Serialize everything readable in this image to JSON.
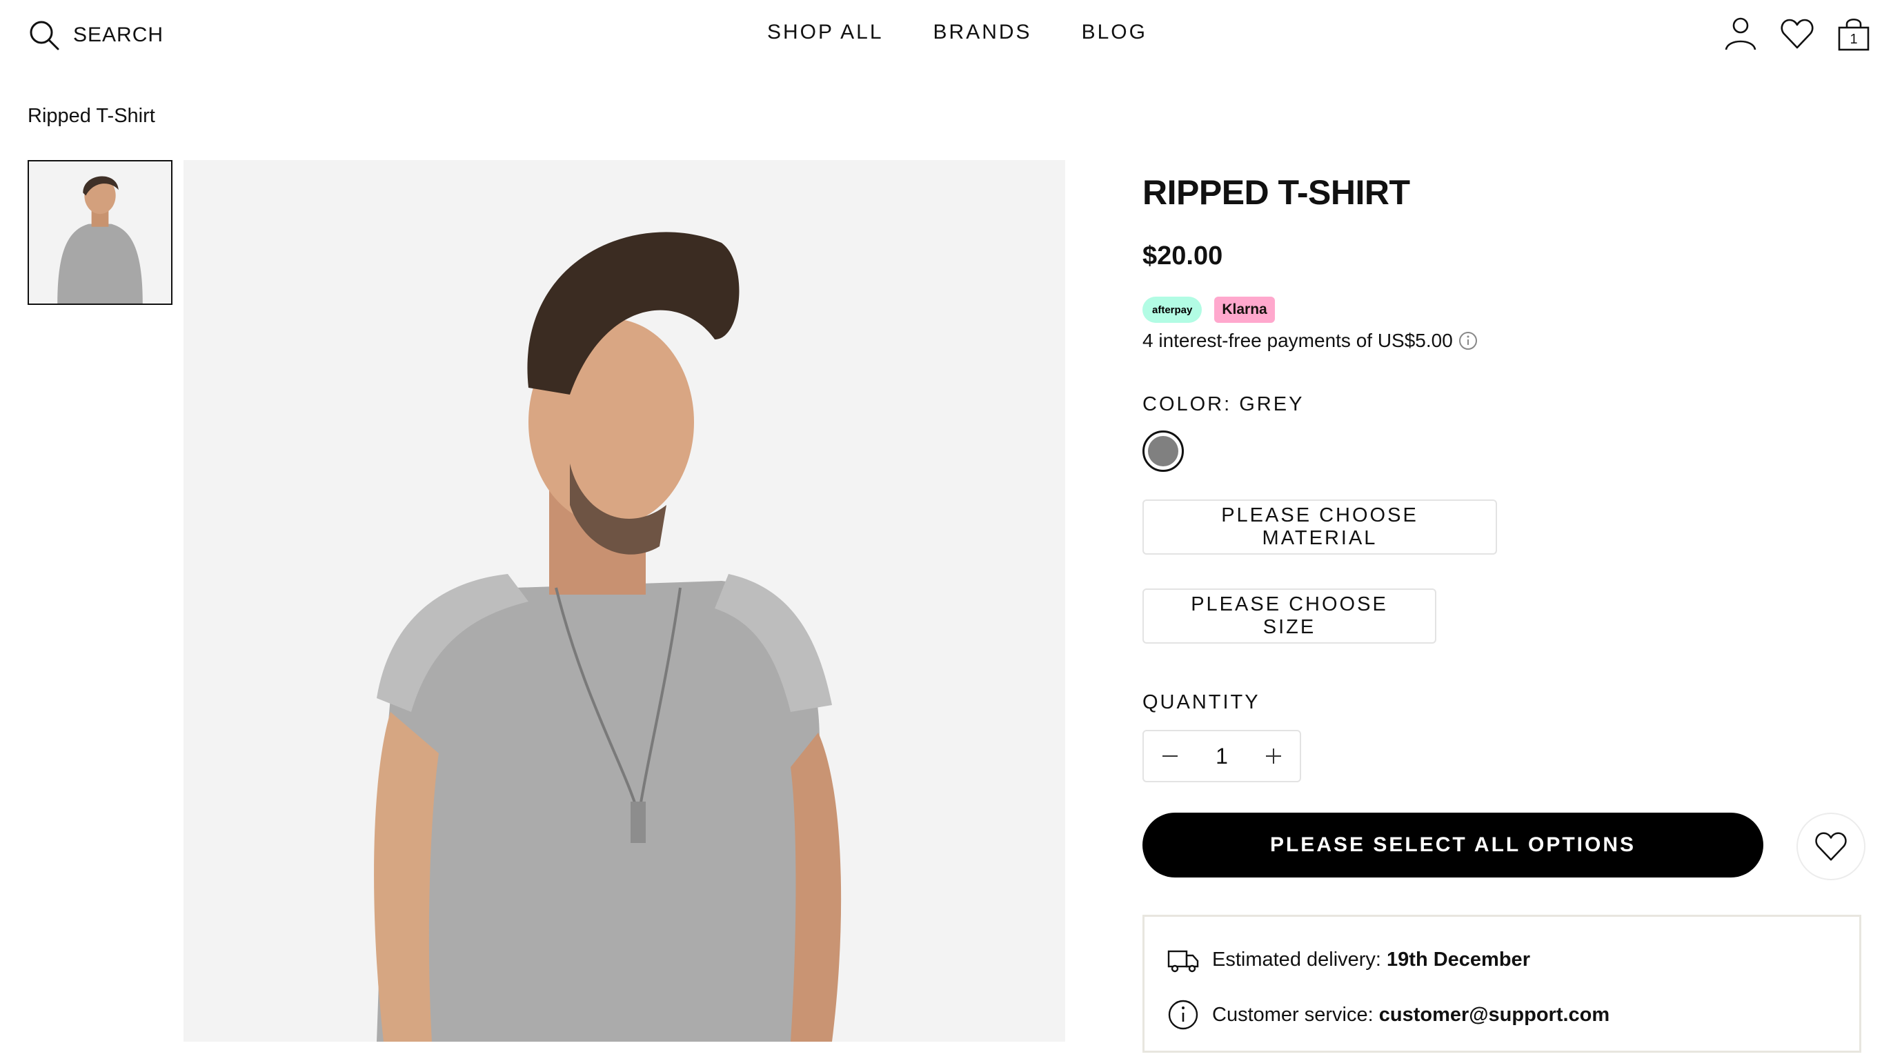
{
  "header": {
    "search_label": "SEARCH",
    "nav": [
      "SHOP ALL",
      "BRANDS",
      "BLOG"
    ],
    "cart_count": "1"
  },
  "breadcrumb": "Ripped T-Shirt",
  "product": {
    "title": "RIPPED T-SHIRT",
    "price": "$20.00",
    "afterpay_label": "afterpay",
    "klarna_label": "Klarna",
    "installments": "4 interest-free payments of US$5.00",
    "color_label": "COLOR: GREY",
    "swatch_color": "#808080",
    "material_button": "PLEASE CHOOSE MATERIAL",
    "size_button": "PLEASE CHOOSE SIZE",
    "quantity_label": "QUANTITY",
    "quantity_value": "1",
    "add_button": "PLEASE SELECT ALL OPTIONS"
  },
  "info_box": {
    "delivery_label": "Estimated delivery: ",
    "delivery_value": "19th December",
    "service_label": "Customer service: ",
    "service_value": "customer@support.com"
  },
  "colors": {
    "text": "#111111",
    "accent_button": "#000000",
    "afterpay": "#b2fce4",
    "klarna": "#ffa8cd",
    "image_bg": "#f3f3f3"
  }
}
